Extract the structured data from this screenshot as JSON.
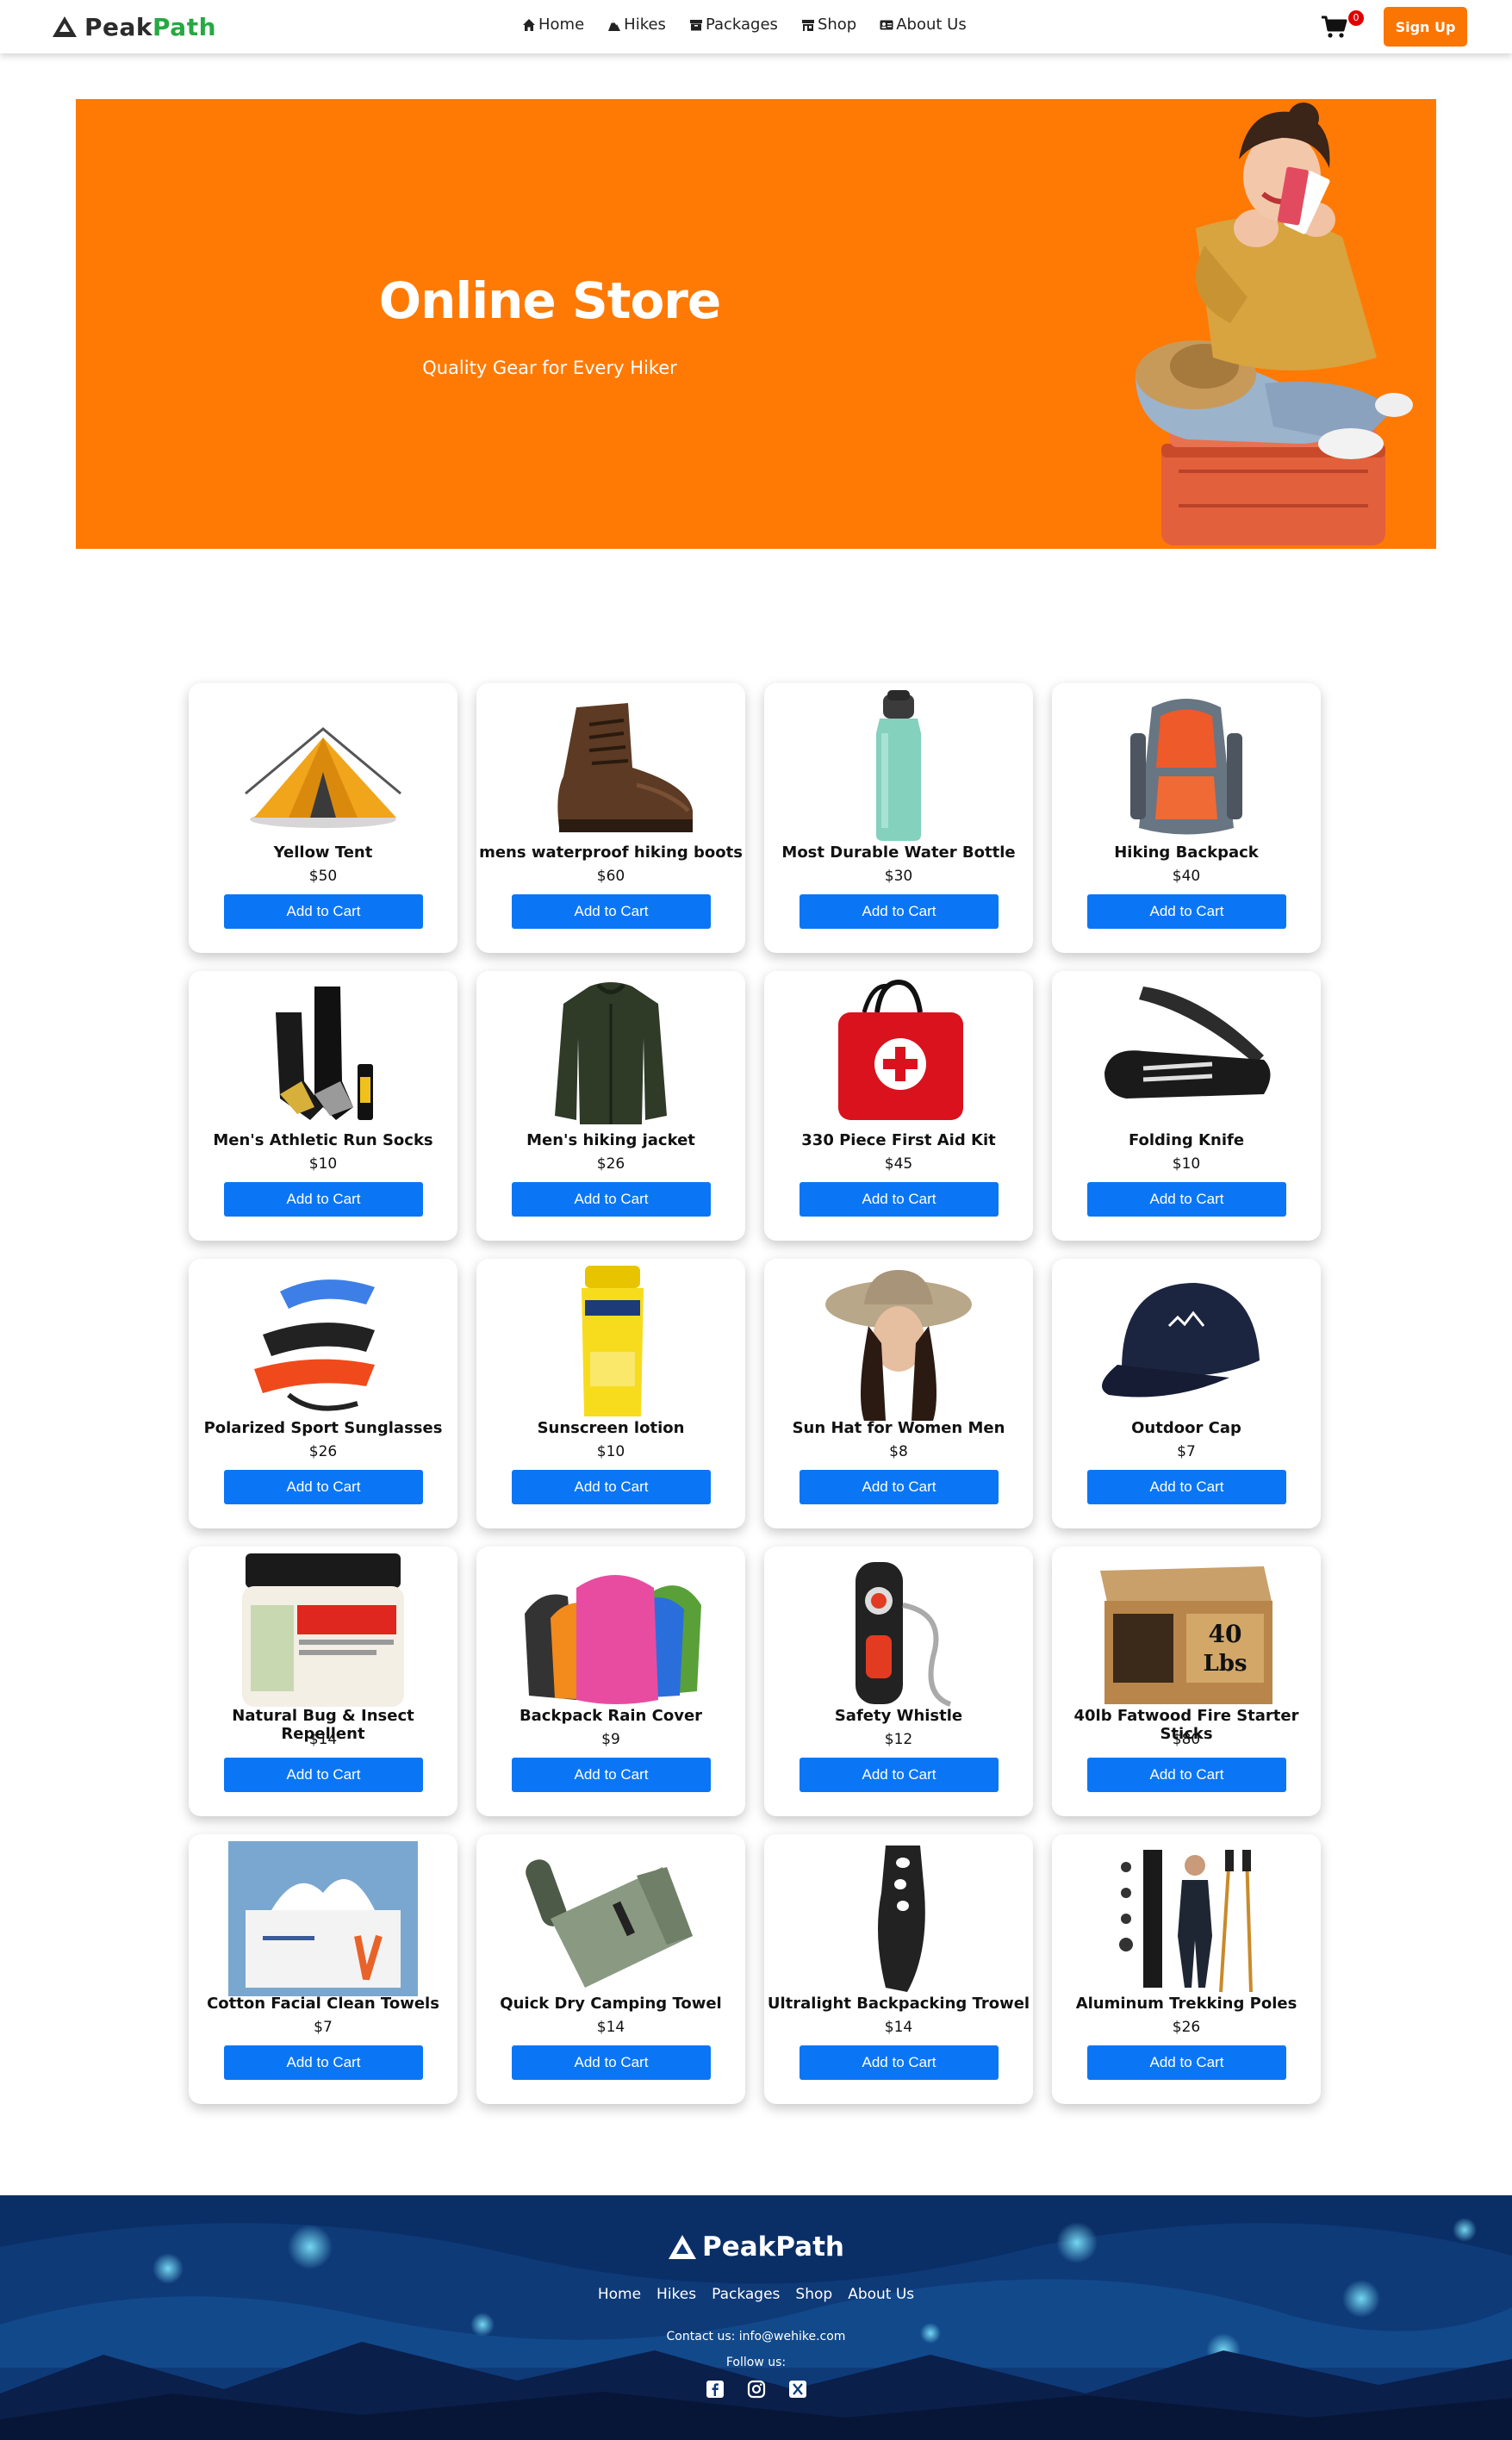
{
  "header": {
    "brand_first": "Peak",
    "brand_second": "Path",
    "nav": [
      {
        "label": "Home",
        "icon": "home-icon"
      },
      {
        "label": "Hikes",
        "icon": "mountain-icon"
      },
      {
        "label": "Packages",
        "icon": "archive-icon"
      },
      {
        "label": "Shop",
        "icon": "store-icon"
      },
      {
        "label": "About Us",
        "icon": "id-card-icon"
      }
    ],
    "cart_count": "0",
    "signup_label": "Sign Up"
  },
  "hero": {
    "title": "Online Store",
    "subtitle": "Quality Gear for Every Hiker",
    "background": "#ff7a04"
  },
  "products": [
    {
      "name": "Yellow Tent",
      "price": "$50",
      "button": "Add to Cart",
      "icon": "tent-icon"
    },
    {
      "name": "mens waterproof hiking boots",
      "price": "$60",
      "button": "Add to Cart",
      "icon": "boot-icon"
    },
    {
      "name": "Most Durable Water Bottle",
      "price": "$30",
      "button": "Add to Cart",
      "icon": "water-bottle-icon"
    },
    {
      "name": "Hiking Backpack",
      "price": "$40",
      "button": "Add to Cart",
      "icon": "backpack-icon"
    },
    {
      "name": "Men's Athletic Run Socks",
      "price": "$10",
      "button": "Add to Cart",
      "icon": "socks-icon"
    },
    {
      "name": "Men's hiking jacket",
      "price": "$26",
      "button": "Add to Cart",
      "icon": "jacket-icon"
    },
    {
      "name": "330 Piece First Aid Kit",
      "price": "$45",
      "button": "Add to Cart",
      "icon": "first-aid-icon"
    },
    {
      "name": "Folding Knife",
      "price": "$10",
      "button": "Add to Cart",
      "icon": "knife-icon"
    },
    {
      "name": "Polarized Sport Sunglasses",
      "price": "$26",
      "button": "Add to Cart",
      "icon": "sunglasses-icon"
    },
    {
      "name": "Sunscreen lotion",
      "price": "$10",
      "button": "Add to Cart",
      "icon": "sunscreen-icon"
    },
    {
      "name": "Sun Hat for Women Men",
      "price": "$8",
      "button": "Add to Cart",
      "icon": "sun-hat-icon"
    },
    {
      "name": "Outdoor Cap",
      "price": "$7",
      "button": "Add to Cart",
      "icon": "cap-icon"
    },
    {
      "name": "Natural Bug & Insect Repellent",
      "price": "$14",
      "button": "Add to Cart",
      "icon": "repellent-jar-icon"
    },
    {
      "name": "Backpack Rain Cover",
      "price": "$9",
      "button": "Add to Cart",
      "icon": "rain-cover-icon"
    },
    {
      "name": "Safety Whistle",
      "price": "$12",
      "button": "Add to Cart",
      "icon": "whistle-icon"
    },
    {
      "name": "40lb Fatwood Fire Starter Sticks",
      "price": "$80",
      "button": "Add to Cart",
      "icon": "firewood-box-icon"
    },
    {
      "name": "Cotton Facial Clean Towels",
      "price": "$7",
      "button": "Add to Cart",
      "icon": "tissue-box-icon"
    },
    {
      "name": "Quick Dry Camping Towel",
      "price": "$14",
      "button": "Add to Cart",
      "icon": "towel-icon"
    },
    {
      "name": "Ultralight Backpacking Trowel",
      "price": "$14",
      "button": "Add to Cart",
      "icon": "trowel-icon"
    },
    {
      "name": "Aluminum Trekking Poles",
      "price": "$26",
      "button": "Add to Cart",
      "icon": "trekking-poles-icon"
    }
  ],
  "footer": {
    "brand": "PeakPath",
    "nav": [
      "Home",
      "Hikes",
      "Packages",
      "Shop",
      "About Us"
    ],
    "contact": "Contact us: info@wehike.com",
    "follow": "Follow us:",
    "social": [
      "facebook-icon",
      "instagram-icon",
      "x-icon"
    ]
  },
  "colors": {
    "accent": "#fb7503",
    "button": "#0b76f5",
    "brand_green": "#27a843",
    "footer": "#0d2f66"
  }
}
